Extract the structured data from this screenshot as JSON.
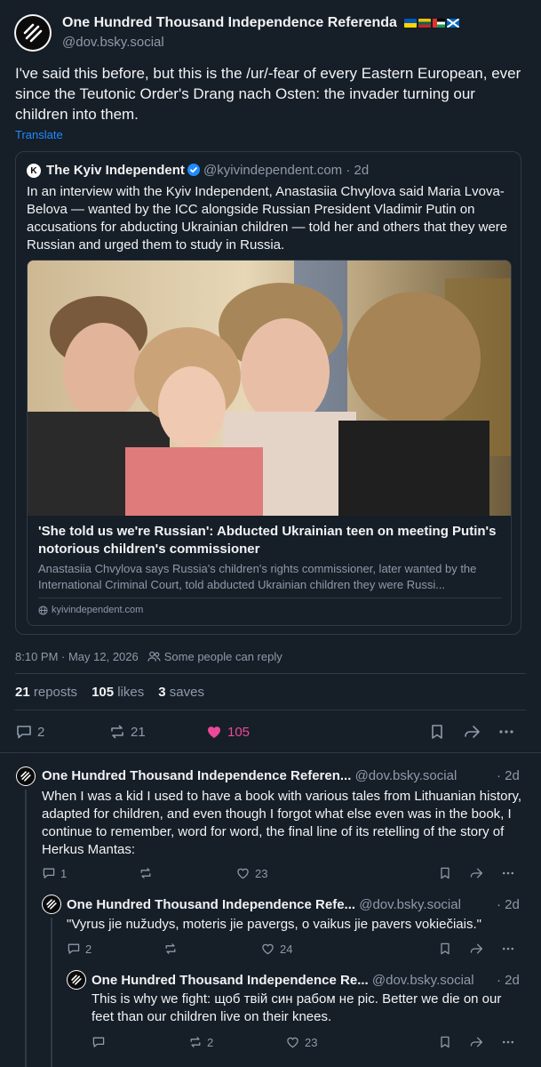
{
  "post": {
    "author_name": "One Hundred Thousand Independence Referenda",
    "author_handle": "@dov.bsky.social",
    "text": "I've said this before, but this is the /ur/-fear of every Eastern European, ever since the Teutonic Order's Drang nach Osten: the invader turning our children into them.",
    "translate_label": "Translate",
    "quote": {
      "author_name": "The Kyiv Independent",
      "avatar_letter": "K",
      "author_handle": "@kyivindependent.com",
      "time": "· 2d",
      "text": "In an interview with the Kyiv Independent, Anastasiia Chvylova said Maria Lvova-Belova — wanted by the ICC alongside Russian President Vladimir Putin on accusations for abducting Ukrainian children — told her and others that they were Russian and urged them to study in Russia.",
      "embed": {
        "title": "'She told us we're Russian': Abducted Ukrainian teen on meeting Putin's notorious children's commissioner",
        "description": "Anastasiia Chvylova says Russia's children's rights commissioner, later wanted by the International Criminal Court, told abducted Ukrainian children they were Russi...",
        "domain": "kyivindependent.com"
      }
    },
    "timestamp": "8:10 PM · May 12, 2026",
    "reply_setting": "Some people can reply",
    "stats": {
      "reposts_count": "21",
      "reposts_label": "reposts",
      "likes_count": "105",
      "likes_label": "likes",
      "saves_count": "3",
      "saves_label": "saves"
    },
    "actions": {
      "replies": "2",
      "reposts": "21",
      "likes": "105"
    }
  },
  "replies": [
    {
      "author_name": "One Hundred Thousand Independence Referen...",
      "author_handle": "@dov.bsky.social",
      "time": "· 2d",
      "text": "When I was a kid I used to have a book with various tales from Lithuanian history, adapted for children, and even though I forgot what else even was in the book, I continue to remember, word for word, the final line of its retelling of the story of Herkus Mantas:",
      "replies": "1",
      "reposts": "",
      "likes": "23"
    },
    {
      "author_name": "One Hundred Thousand Independence Refe...",
      "author_handle": "@dov.bsky.social",
      "time": "· 2d",
      "text": "\"Vyrus jie nužudys, moteris jie pavergs, o vaikus jie pavers vokiečiais.\"",
      "replies": "2",
      "reposts": "",
      "likes": "24"
    },
    {
      "author_name": "One Hundred Thousand Independence Re...",
      "author_handle": "@dov.bsky.social",
      "time": "· 2d",
      "text": "This is why we fight: щоб твій син рабом не рic. Better we die on our feet than our children live on their knees.",
      "replies": "",
      "reposts": "2",
      "likes": "23"
    }
  ],
  "colors": {
    "background": "#161e27",
    "border": "#2e3a47",
    "muted": "#8d9bab",
    "link": "#208bfe",
    "like": "#ec4899"
  }
}
